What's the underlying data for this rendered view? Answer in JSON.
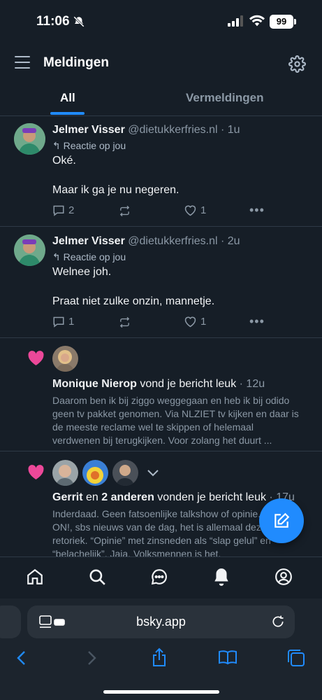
{
  "status_bar": {
    "time": "11:06",
    "battery": "99"
  },
  "header": {
    "title": "Meldingen"
  },
  "tabs": [
    {
      "label": "All",
      "active": true
    },
    {
      "label": "Vermeldingen",
      "active": false
    }
  ],
  "notifications": [
    {
      "name": "Jelmer Visser",
      "handle": "@dietukkerfries.nl",
      "time": "· 1u",
      "context": "Reactie op jou",
      "lines": [
        "Oké.",
        "Maar ik ga je nu negeren."
      ],
      "replies": "2",
      "likes": "1"
    },
    {
      "name": "Jelmer Visser",
      "handle": "@dietukkerfries.nl",
      "time": "· 2u",
      "context": "Reactie op jou",
      "lines": [
        "Welnee joh.",
        "Praat niet zulke onzin, mannetje."
      ],
      "replies": "1",
      "likes": "1"
    }
  ],
  "likes": [
    {
      "actor": "Monique Nierop",
      "action": " vond je bericht leuk",
      "time": " · 12u",
      "text": "Daarom ben ik bij ziggo weggegaan en heb ik bij odido geen tv pakket genomen. Via NLZIET tv kijken en daar is de meeste reclame wel te skippen of helemaal verdwenen bij terugkijken. Voor zolang het duurt ..."
    },
    {
      "actor": "Gerrit",
      "joiner": " en ",
      "others": "2 anderen",
      "action": " vonden je bericht leuk",
      "time": " · 17u",
      "text": "Inderdaad. Geen fatsoenlijke talkshow of opinie. Jinek, ON!, sbs nieuws van de dag, het is allemaal dezelfde retoriek. “Opinie” met zinsneden als “slap gelul” en “belachelijk”.  Jaja. Volksmennen is het."
    }
  ],
  "browser": {
    "url": "bsky.app"
  },
  "colors": {
    "accent": "#208bfe",
    "like": "#ec4899",
    "background": "#161e27"
  },
  "icons": [
    "menu-icon",
    "gear-icon",
    "reply-icon",
    "repost-icon",
    "heart-icon",
    "more-icon",
    "compose-icon",
    "home-icon",
    "search-icon",
    "chat-icon",
    "bell-icon",
    "profile-icon",
    "back-icon",
    "forward-icon",
    "share-icon",
    "bookmarks-icon",
    "tabs-icon",
    "reload-icon"
  ]
}
